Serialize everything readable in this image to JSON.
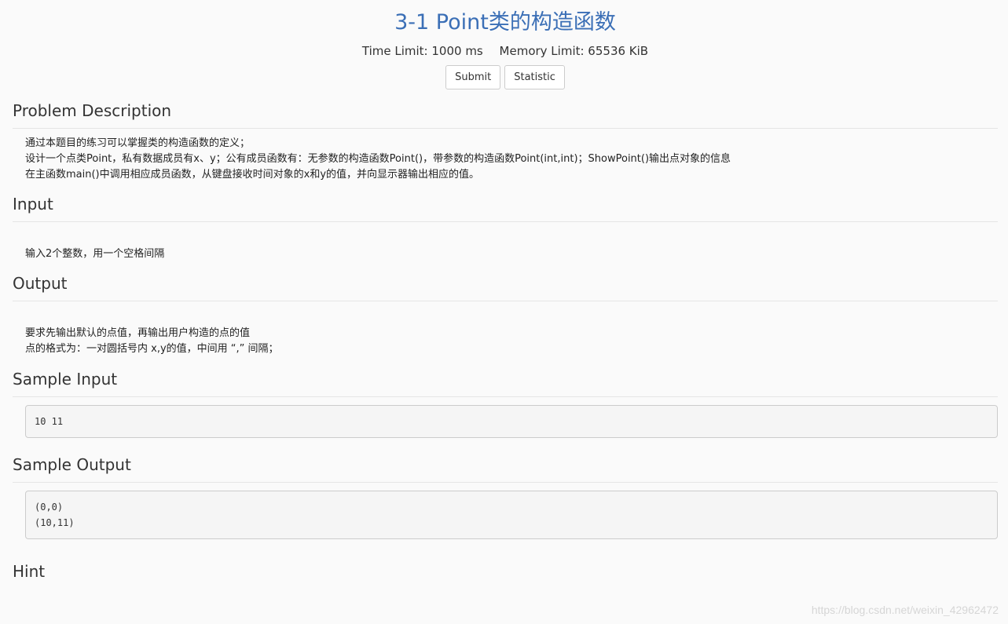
{
  "problem": {
    "title": "3-1 Point类的构造函数",
    "time_limit": "Time Limit: 1000 ms",
    "memory_limit": "Memory Limit: 65536 KiB",
    "submit_label": "Submit",
    "statistic_label": "Statistic"
  },
  "sections": {
    "description": {
      "heading": "Problem Description",
      "lines": [
        "通过本题目的练习可以掌握类的构造函数的定义；",
        "设计一个点类Point，私有数据成员有x、y；公有成员函数有：无参数的构造函数Point()，带参数的构造函数Point(int,int)；ShowPoint()输出点对象的信息",
        "在主函数main()中调用相应成员函数，从键盘接收时间对象的x和y的值，并向显示器输出相应的值。"
      ]
    },
    "input": {
      "heading": "Input",
      "lines": [
        "输入2个整数，用一个空格间隔"
      ]
    },
    "output": {
      "heading": "Output",
      "lines": [
        "要求先输出默认的点值，再输出用户构造的点的值",
        "点的格式为：一对圆括号内 x,y的值，中间用 “,” 间隔；"
      ]
    },
    "sample_input": {
      "heading": "Sample Input",
      "content": "10 11"
    },
    "sample_output": {
      "heading": "Sample Output",
      "content": "(0,0)\n(10,11)"
    },
    "hint": {
      "heading": "Hint"
    }
  },
  "watermark": "https://blog.csdn.net/weixin_42962472"
}
